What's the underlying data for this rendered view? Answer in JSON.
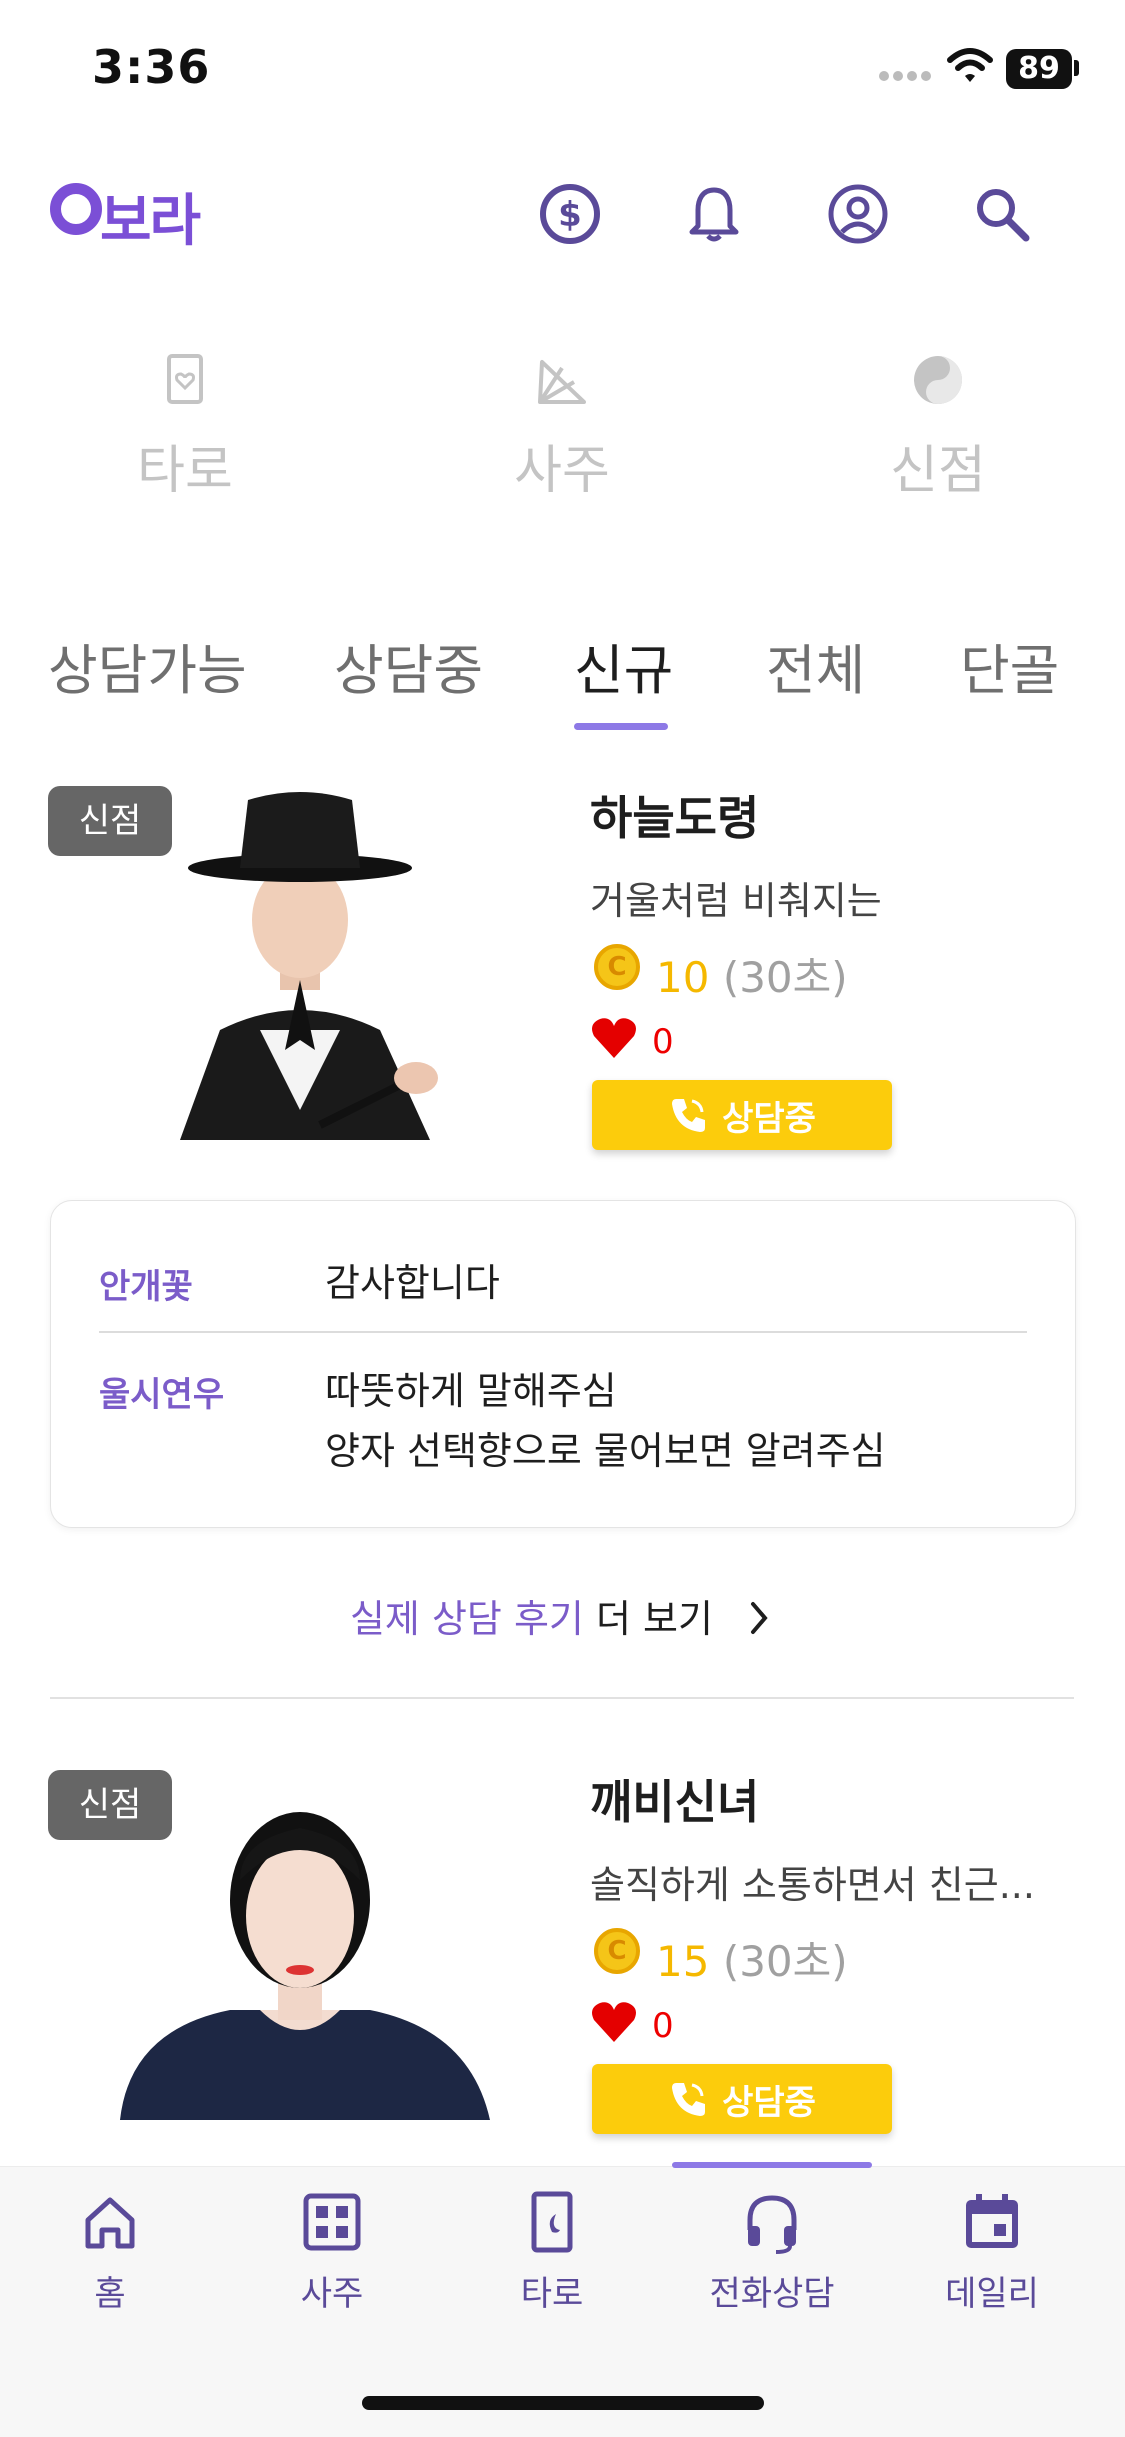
{
  "status_bar": {
    "time": "3:36",
    "battery": "89"
  },
  "header": {
    "logo_text": "보라"
  },
  "categories": [
    {
      "label": "타로",
      "icon": "tarot-card-icon"
    },
    {
      "label": "사주",
      "icon": "fan-icon"
    },
    {
      "label": "신점",
      "icon": "yin-yang-icon"
    }
  ],
  "tabs": [
    {
      "label": "상담가능"
    },
    {
      "label": "상담중"
    },
    {
      "label": "신규",
      "active": true
    },
    {
      "label": "전체"
    },
    {
      "label": "단골"
    }
  ],
  "counselors": [
    {
      "badge": "신점",
      "name": "하늘도령",
      "intro": "거울처럼 비춰지는",
      "coin": "C",
      "price": "10",
      "price_unit": "(30초)",
      "likes": "0",
      "call_label": "상담중"
    },
    {
      "badge": "신점",
      "name": "깨비신녀",
      "intro": "솔직하게 소통하면서 친근...",
      "coin": "C",
      "price": "15",
      "price_unit": "(30초)",
      "likes": "0",
      "call_label": "상담중"
    }
  ],
  "reviews": [
    {
      "reviewer": "안개꽃",
      "lines": [
        "감사합니다"
      ]
    },
    {
      "reviewer": "울시연우",
      "lines": [
        "따뜻하게 말해주심",
        "양자 선택향으로 물어보면 알려주심"
      ]
    }
  ],
  "more_reviews": {
    "highlight": "실제 상담 후기",
    "rest": "더 보기"
  },
  "bottom_nav": [
    {
      "label": "홈",
      "icon": "home-icon"
    },
    {
      "label": "사주",
      "icon": "grid-icon"
    },
    {
      "label": "타로",
      "icon": "tarot-card-icon"
    },
    {
      "label": "전화상담",
      "icon": "headset-icon",
      "active": true
    },
    {
      "label": "데일리",
      "icon": "calendar-icon"
    }
  ],
  "colors": {
    "accent": "#7b4fd6",
    "call_button": "#fccc0c",
    "price": "#f5b800",
    "like": "#e00000",
    "tab_indicator": "#8d79e6"
  }
}
